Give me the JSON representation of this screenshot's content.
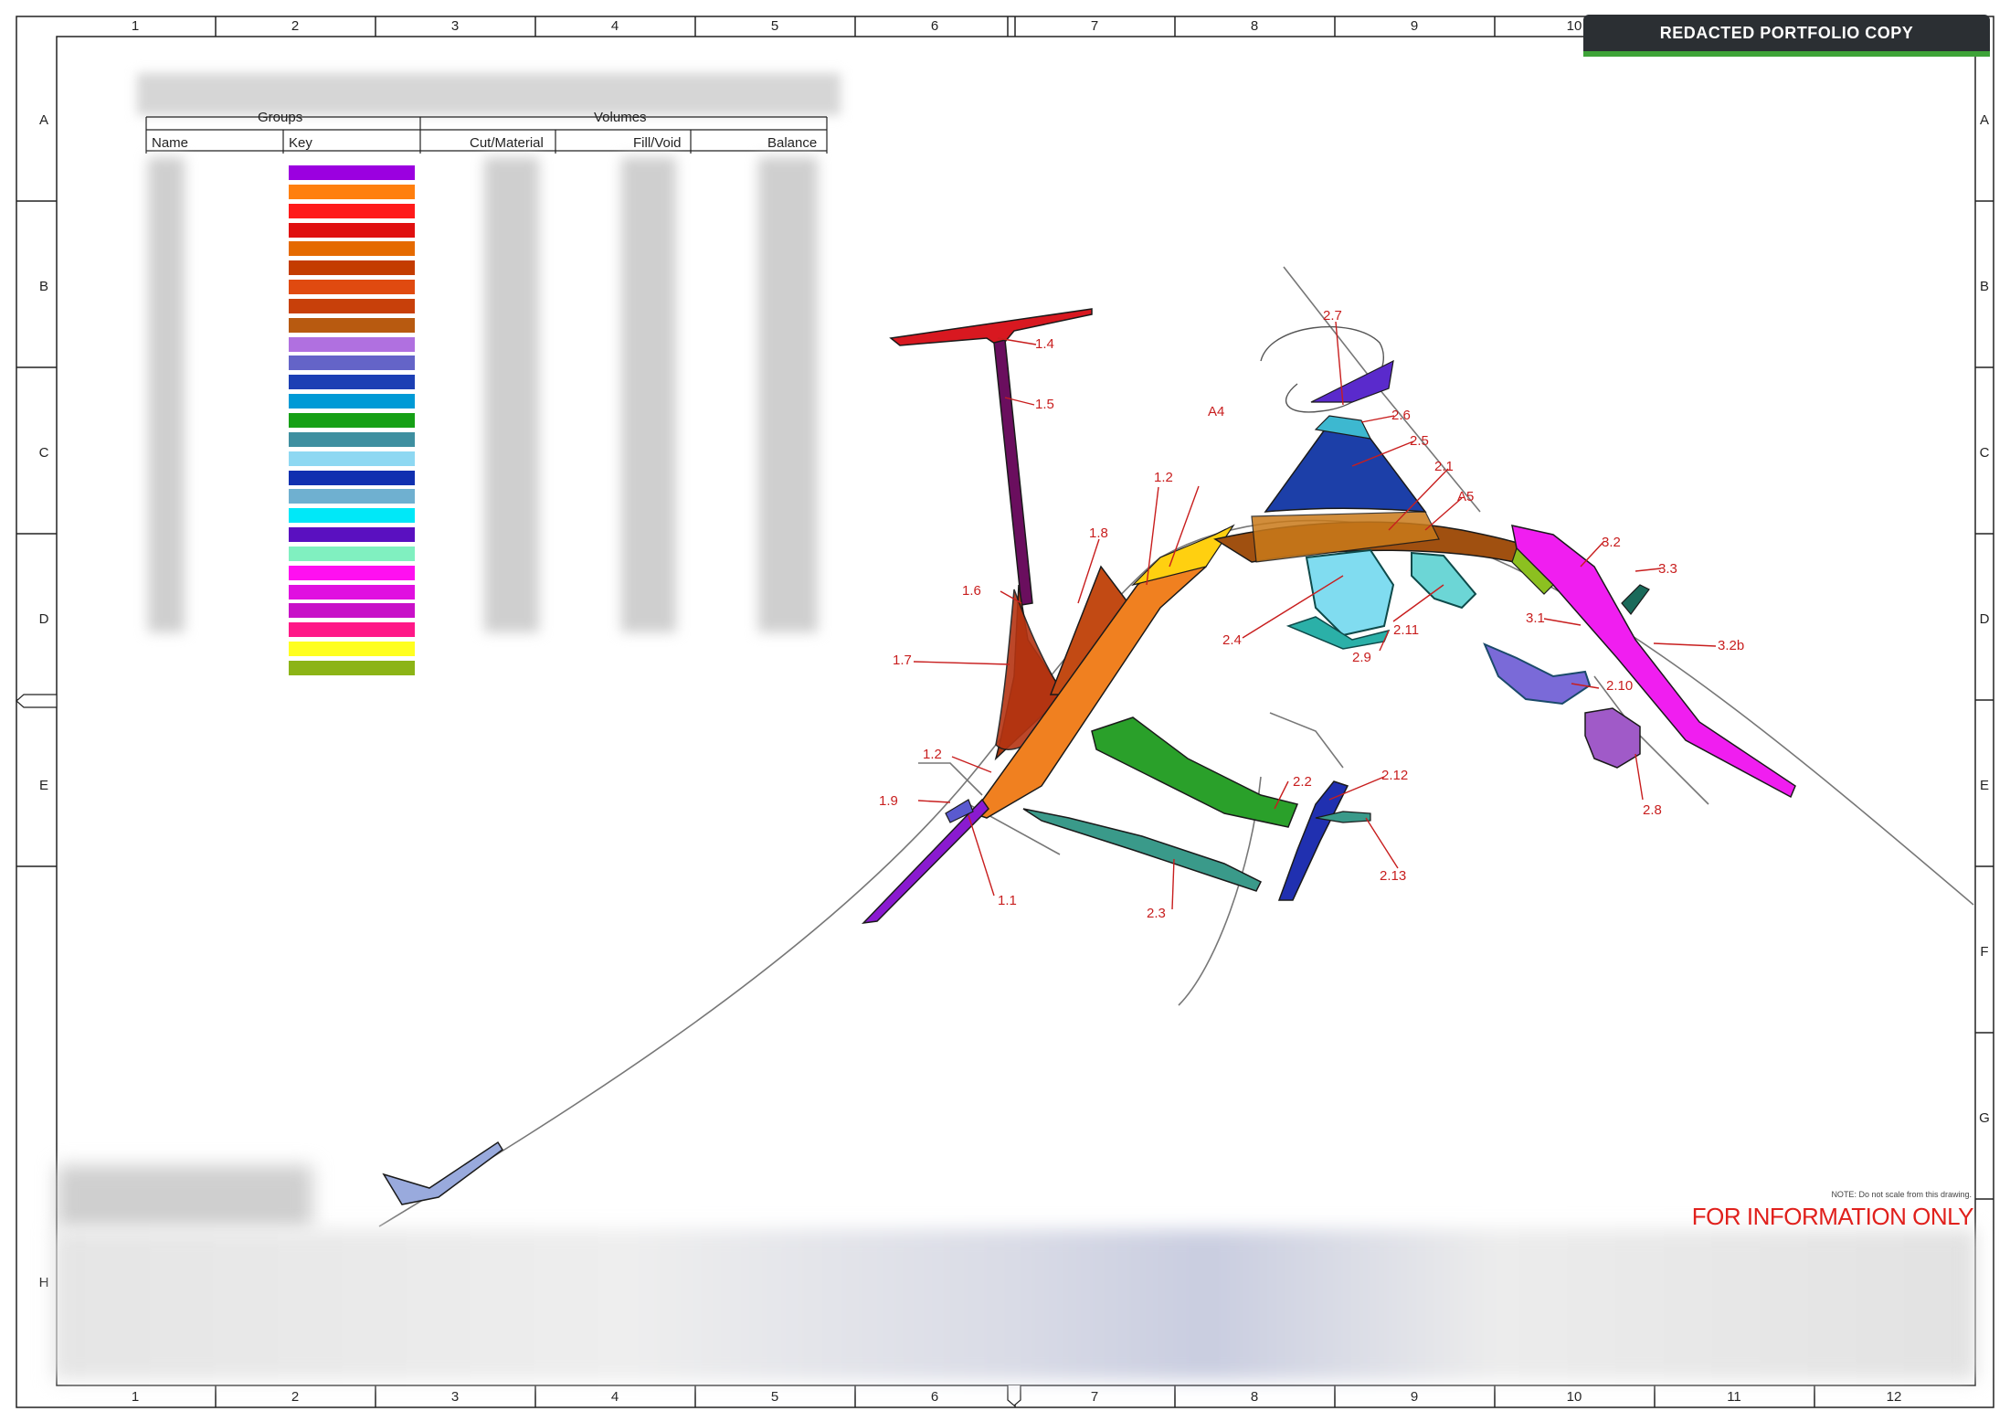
{
  "banner": {
    "text": "REDACTED PORTFOLIO COPY"
  },
  "grid": {
    "columns": [
      "1",
      "2",
      "3",
      "4",
      "5",
      "6",
      "7",
      "8",
      "9",
      "10",
      "11",
      "12"
    ],
    "rows": [
      "A",
      "B",
      "C",
      "D",
      "E",
      "F",
      "G",
      "H"
    ]
  },
  "table": {
    "group_header": "Groups",
    "volume_header": "Volumes",
    "columns": [
      "Name",
      "Key",
      "Cut/Material",
      "Fill/Void",
      "Balance"
    ],
    "key_colors": [
      "#9b00e0",
      "#ff7f0e",
      "#ff1a1a",
      "#e01010",
      "#e56a00",
      "#c43c00",
      "#e04a10",
      "#c8400a",
      "#b85a10",
      "#b070e0",
      "#6464c8",
      "#1c3fb4",
      "#009ad6",
      "#16a016",
      "#3e8fa0",
      "#8ed8f2",
      "#1030b0",
      "#6fb0d0",
      "#00e8f8",
      "#5a10c0",
      "#80f0c0",
      "#ff10f0",
      "#e010e0",
      "#c810c8",
      "#ff1888",
      "#ffff20",
      "#8cb416"
    ]
  },
  "labels": [
    "1.1",
    "1.2",
    "1.2",
    "1.4",
    "1.5",
    "1.6",
    "1.7",
    "1.8",
    "1.9",
    "A4",
    "A5",
    "2.1",
    "2.2",
    "2.3",
    "2.4",
    "2.5",
    "2.6",
    "2.7",
    "2.8",
    "2.9",
    "2.10",
    "2.11",
    "2.12",
    "2.13",
    "3.1",
    "3.2",
    "3.2b",
    "3.3"
  ],
  "footer": {
    "note": "NOTE: Do not scale from this drawing.",
    "status": "FOR INFORMATION ONLY"
  }
}
